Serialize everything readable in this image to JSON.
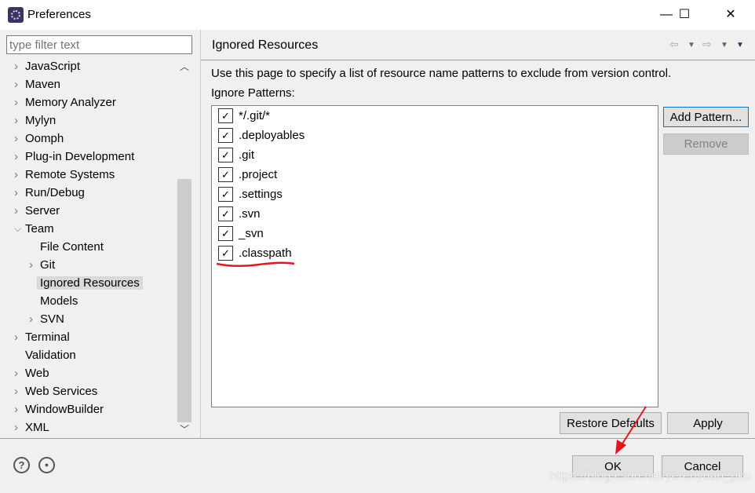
{
  "window": {
    "title": "Preferences",
    "minimize": "—",
    "maximize": "☐",
    "close": "✕",
    "app_icon": "eclipse-icon"
  },
  "filter": {
    "placeholder": "type filter text"
  },
  "tree": [
    {
      "label": "JavaScript",
      "level": 0,
      "expander": "collapsed"
    },
    {
      "label": "Maven",
      "level": 0,
      "expander": "collapsed"
    },
    {
      "label": "Memory Analyzer",
      "level": 0,
      "expander": "collapsed"
    },
    {
      "label": "Mylyn",
      "level": 0,
      "expander": "collapsed"
    },
    {
      "label": "Oomph",
      "level": 0,
      "expander": "collapsed"
    },
    {
      "label": "Plug-in Development",
      "level": 0,
      "expander": "collapsed"
    },
    {
      "label": "Remote Systems",
      "level": 0,
      "expander": "collapsed"
    },
    {
      "label": "Run/Debug",
      "level": 0,
      "expander": "collapsed"
    },
    {
      "label": "Server",
      "level": 0,
      "expander": "collapsed"
    },
    {
      "label": "Team",
      "level": 0,
      "expander": "expanded"
    },
    {
      "label": "File Content",
      "level": 1,
      "expander": "none"
    },
    {
      "label": "Git",
      "level": 1,
      "expander": "collapsed"
    },
    {
      "label": "Ignored Resources",
      "level": 1,
      "expander": "none",
      "selected": true
    },
    {
      "label": "Models",
      "level": 1,
      "expander": "none"
    },
    {
      "label": "SVN",
      "level": 1,
      "expander": "collapsed"
    },
    {
      "label": "Terminal",
      "level": 0,
      "expander": "collapsed"
    },
    {
      "label": "Validation",
      "level": 0,
      "expander": "none"
    },
    {
      "label": "Web",
      "level": 0,
      "expander": "collapsed"
    },
    {
      "label": "Web Services",
      "level": 0,
      "expander": "collapsed"
    },
    {
      "label": "WindowBuilder",
      "level": 0,
      "expander": "collapsed"
    },
    {
      "label": "XML",
      "level": 0,
      "expander": "collapsed"
    }
  ],
  "page": {
    "title": "Ignored Resources",
    "description": "Use this page to specify a list of resource name patterns to exclude from version control.",
    "patterns_label": "Ignore Patterns:",
    "patterns": [
      {
        "label": "*/.git/*",
        "checked": true
      },
      {
        "label": ".deployables",
        "checked": true
      },
      {
        "label": ".git",
        "checked": true
      },
      {
        "label": ".project",
        "checked": true
      },
      {
        "label": ".settings",
        "checked": true
      },
      {
        "label": ".svn",
        "checked": true
      },
      {
        "label": "_svn",
        "checked": true
      },
      {
        "label": ".classpath",
        "checked": true
      }
    ],
    "add_pattern": "Add Pattern...",
    "remove": "Remove",
    "restore_defaults": "Restore Defaults",
    "apply": "Apply"
  },
  "footer": {
    "help_icon": "?",
    "ok": "OK",
    "cancel": "Cancel"
  },
  "watermark": "https://blog.csdn.net/yerenyuan_pku",
  "annotation_color": "#e8141b"
}
